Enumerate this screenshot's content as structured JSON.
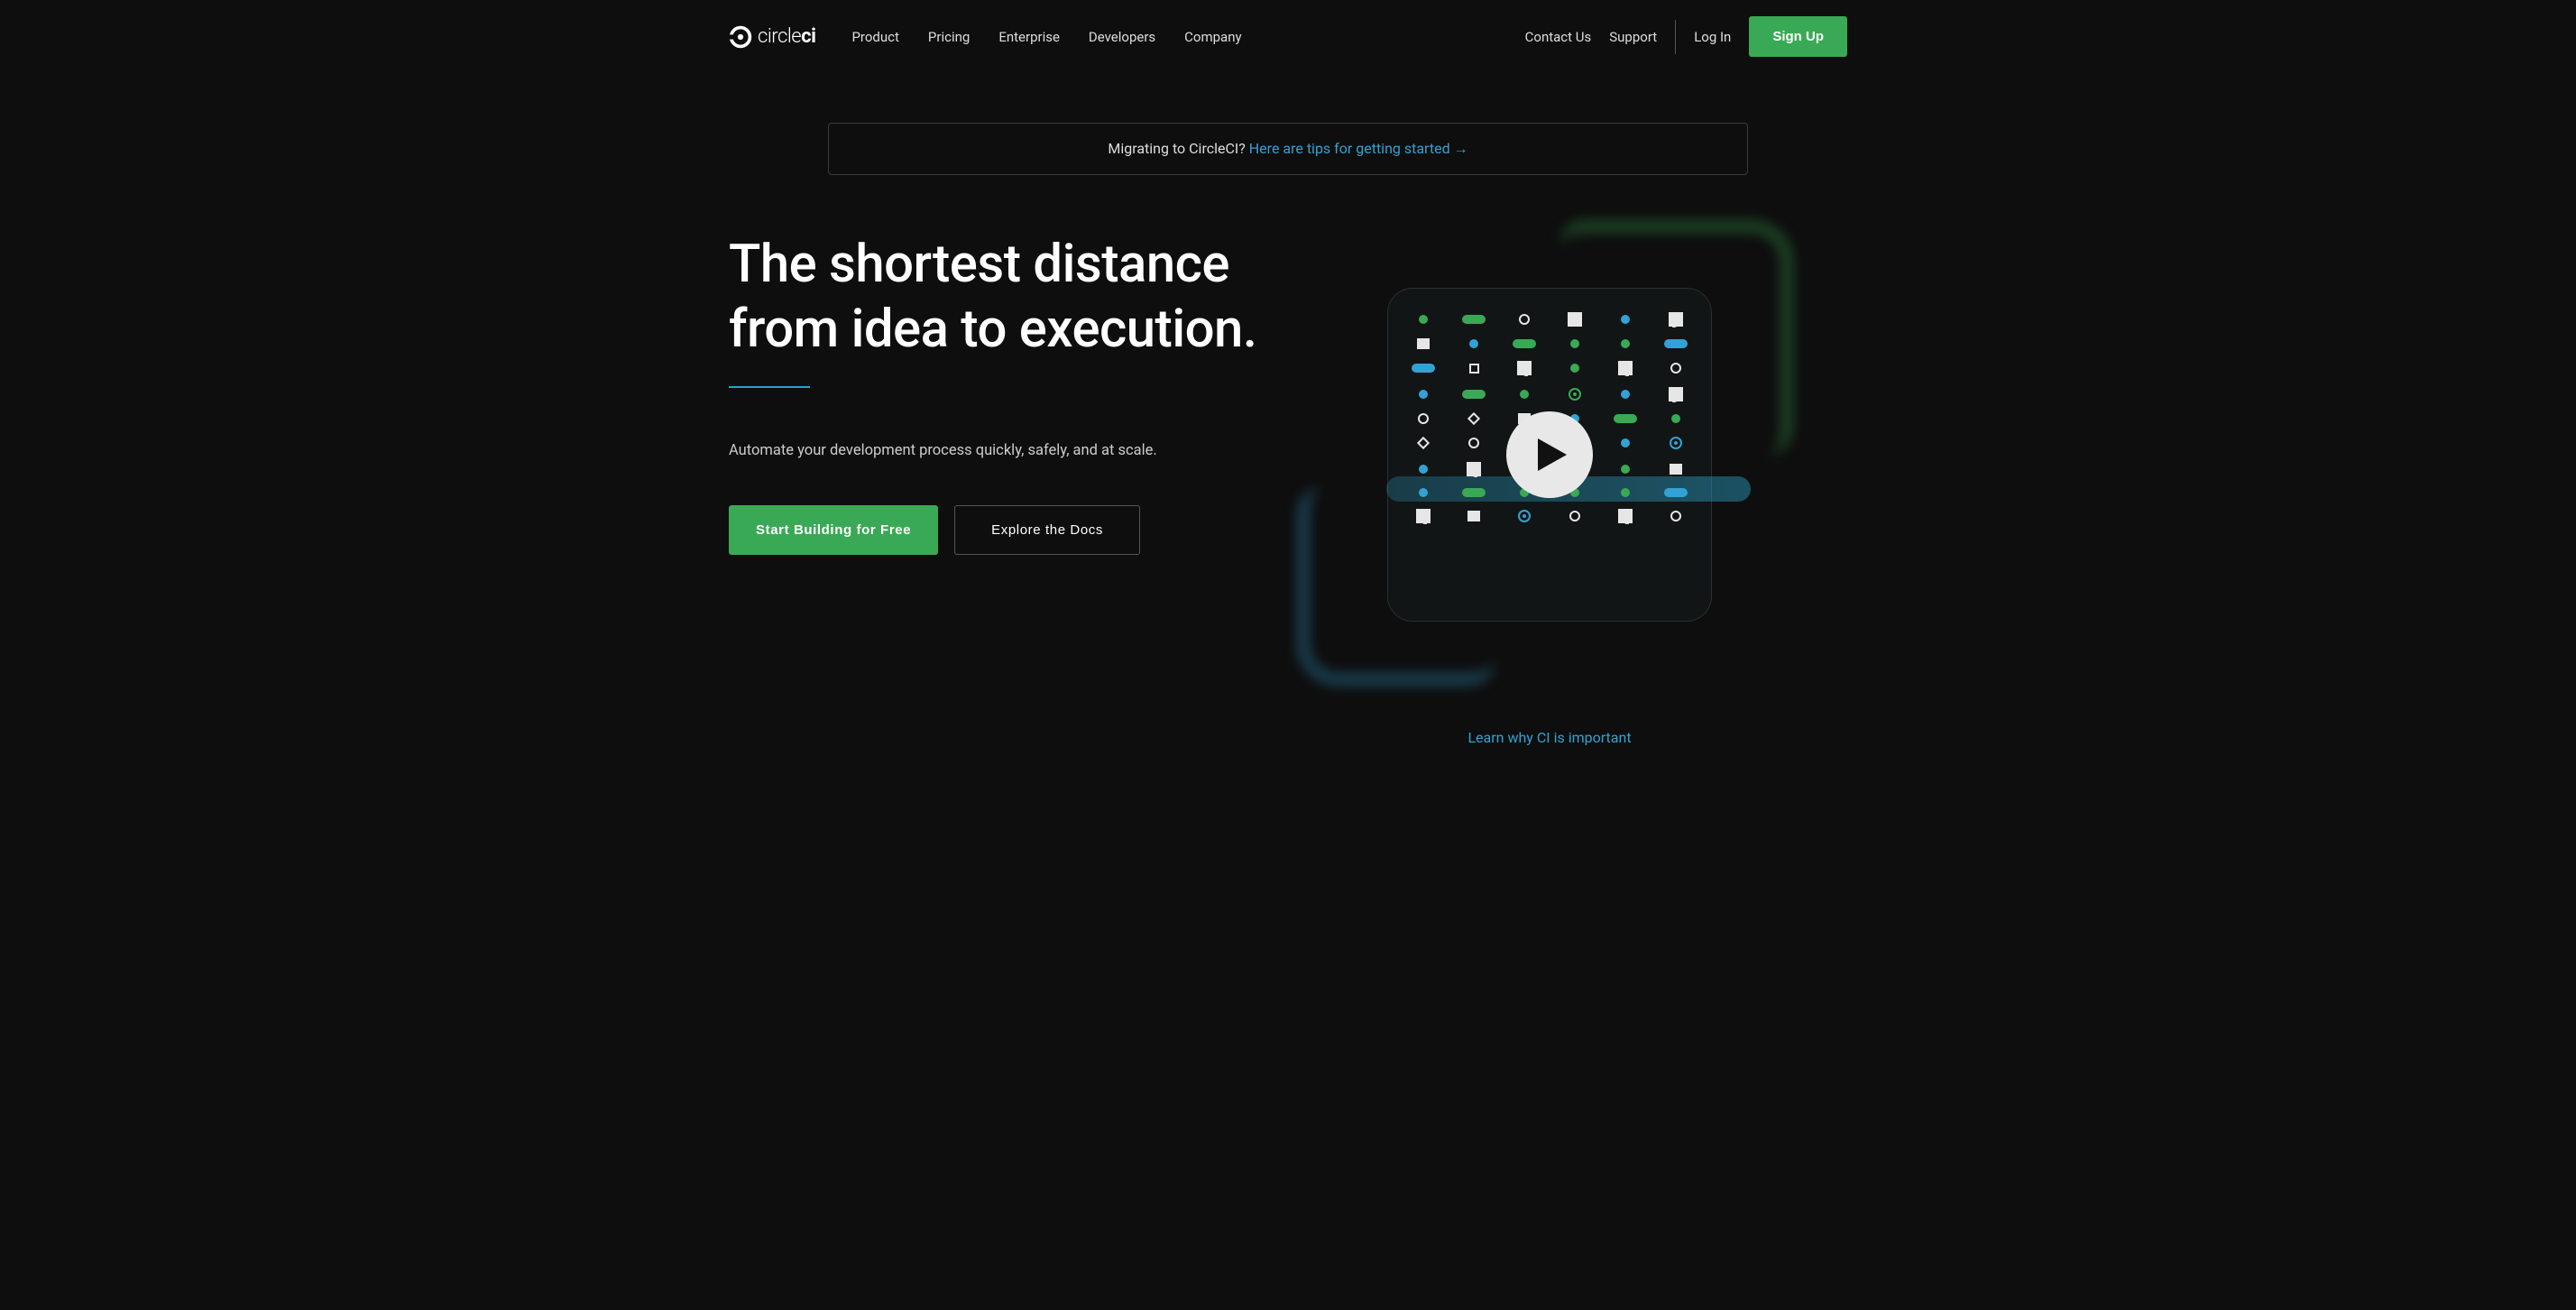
{
  "brand": {
    "name_light": "circle",
    "name_bold": "ci"
  },
  "nav": {
    "primary": [
      "Product",
      "Pricing",
      "Enterprise",
      "Developers",
      "Company"
    ],
    "contact": "Contact Us",
    "support": "Support",
    "login": "Log In",
    "signup": "Sign Up"
  },
  "banner": {
    "lead": "Migrating to CircleCI? ",
    "link": "Here are tips for getting started"
  },
  "hero": {
    "title": "The shortest distance from idea to execution.",
    "description": "Automate your development process quickly, safely, and at scale.",
    "cta_primary": "Start Building for Free",
    "cta_secondary": "Explore the Docs",
    "learn_link": "Learn why CI is important"
  },
  "colors": {
    "green": "#3aa955",
    "blue": "#32a2d4",
    "bg": "#0e0e0e"
  }
}
